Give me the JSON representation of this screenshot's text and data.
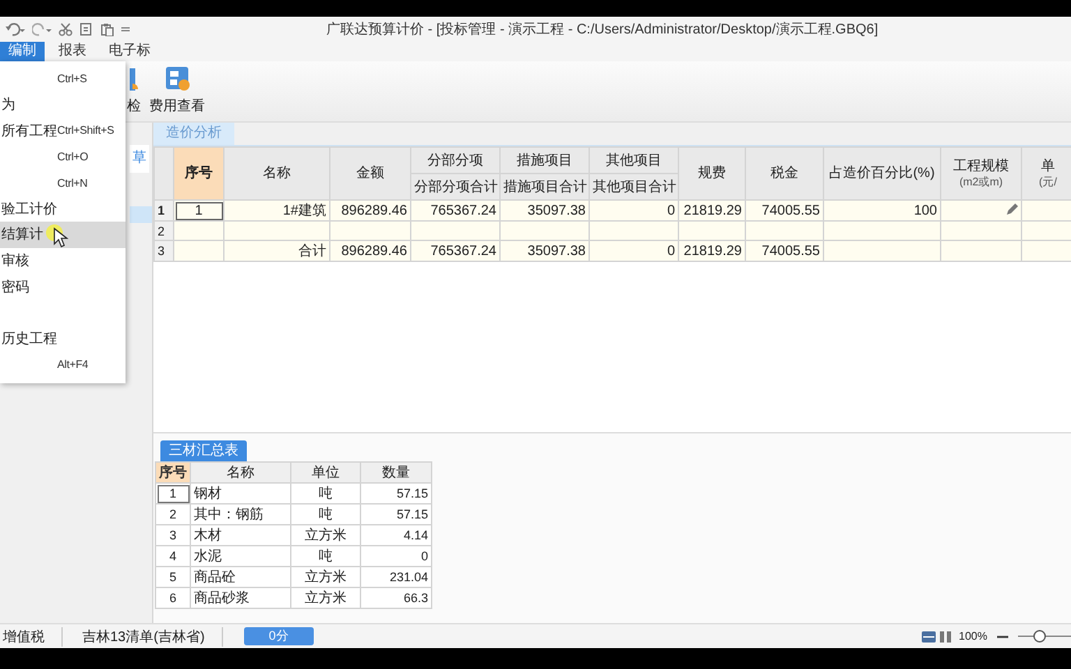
{
  "title_bar": {
    "title": "广联达预算计价 - [投标管理 - 演示工程 - C:/Users/Administrator/Desktop/演示工程.GBQ6]"
  },
  "menu_bar": [
    {
      "label": "编制",
      "selected": true
    },
    {
      "label": "报表",
      "selected": false
    },
    {
      "label": "电子标",
      "selected": false
    }
  ],
  "ribbon": [
    {
      "label": "检",
      "kind": "check"
    },
    {
      "label": "费用查看",
      "kind": "cost"
    }
  ],
  "file_menu": [
    {
      "kind": "item",
      "shortcut": "Ctrl+S",
      "selected": false
    },
    {
      "kind": "item",
      "label": "为",
      "selected": false
    },
    {
      "kind": "item",
      "label": "所有工程",
      "shortcut": "Ctrl+Shift+S",
      "selected": false
    },
    {
      "kind": "item",
      "shortcut": "Ctrl+O",
      "selected": false
    },
    {
      "kind": "item",
      "shortcut": "Ctrl+N",
      "selected": false
    },
    {
      "kind": "item",
      "label": "验工计价",
      "selected": false
    },
    {
      "kind": "item",
      "label": "结算计",
      "selected": true
    },
    {
      "kind": "item",
      "label": "审核",
      "selected": false
    },
    {
      "kind": "item",
      "label": "密码",
      "selected": false
    },
    {
      "kind": "spacer"
    },
    {
      "kind": "item",
      "label": "历史工程",
      "selected": false
    },
    {
      "kind": "item",
      "shortcut": "Alt+F4",
      "selected": false
    }
  ],
  "sidebar": {
    "tab": "草",
    "rows": [
      {
        "selected": true
      }
    ]
  },
  "tabs": [
    {
      "label": "造价分析",
      "selected": true
    }
  ],
  "table": {
    "columns": [
      {
        "label": "序号",
        "kind": "index"
      },
      {
        "label": "名称",
        "kind": "number"
      },
      {
        "label": "金额",
        "kind": "number"
      },
      {
        "group": "分部分项",
        "label": "分部分项合计",
        "kind": "number"
      },
      {
        "group": "措施项目",
        "label": "措施项目合计",
        "kind": "number"
      },
      {
        "group": "其他项目",
        "label": "其他项目合计",
        "kind": "number"
      },
      {
        "label": "规费",
        "kind": "number"
      },
      {
        "label": "税金",
        "kind": "number"
      },
      {
        "label": "占造价百分比(%)",
        "kind": "number"
      },
      {
        "label": "工程规模",
        "unit": "(m2或m)",
        "kind": "edit"
      },
      {
        "label": "单",
        "unit": "(元/",
        "kind": "number"
      }
    ],
    "rows": [
      {
        "number": "1",
        "selected": true,
        "editable": true,
        "cells": [
          "1",
          "1#建筑",
          "896289.46",
          "765367.24",
          "35097.38",
          "0",
          "21819.29",
          "74005.55",
          "100",
          null,
          null
        ]
      },
      {
        "number": "2",
        "selected": false,
        "editable": false,
        "cells": [
          null,
          null,
          null,
          null,
          null,
          null,
          null,
          null,
          null,
          null,
          null
        ]
      },
      {
        "number": "3",
        "selected": false,
        "editable": false,
        "cells": [
          null,
          "合计",
          "896289.46",
          "765367.24",
          "35097.38",
          "0",
          "21819.29",
          "74005.55",
          null,
          null,
          null
        ]
      }
    ]
  },
  "materials": {
    "title": "三材汇总表",
    "columns": [
      {
        "label": "序号",
        "kind": "index"
      },
      {
        "label": "名称",
        "kind": "text"
      },
      {
        "label": "单位",
        "kind": "center"
      },
      {
        "label": "数量",
        "kind": "number"
      }
    ],
    "rows": [
      {
        "selected": true,
        "cells": [
          "1",
          "钢材",
          "吨",
          "57.15"
        ]
      },
      {
        "selected": false,
        "cells": [
          "2",
          "其中：钢筋",
          "吨",
          "57.15"
        ]
      },
      {
        "selected": false,
        "cells": [
          "3",
          "木材",
          "立方米",
          "4.14"
        ]
      },
      {
        "selected": false,
        "cells": [
          "4",
          "水泥",
          "吨",
          "0"
        ]
      },
      {
        "selected": false,
        "cells": [
          "5",
          "商品砼",
          "立方米",
          "231.04"
        ]
      },
      {
        "selected": false,
        "cells": [
          "6",
          "商品砂浆",
          "立方米",
          "66.3"
        ]
      }
    ]
  },
  "status_bar": {
    "items": [
      "增值税",
      "吉林13清单(吉林省)"
    ],
    "button": "0分",
    "zoom": "100%",
    "zoom_slider": {
      "level": 0.4
    }
  }
}
